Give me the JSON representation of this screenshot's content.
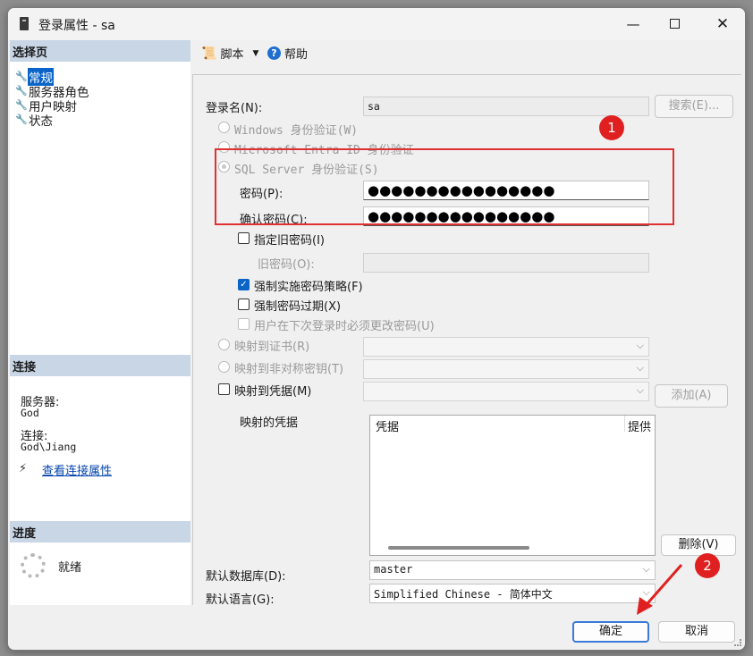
{
  "window": {
    "title": "登录属性 - sa"
  },
  "left": {
    "select_page_header": "选择页",
    "nav_items": [
      "常规",
      "服务器角色",
      "用户映射",
      "状态"
    ],
    "connection_header": "连接",
    "server_label": "服务器:",
    "server_value": "God",
    "connection_label": "连接:",
    "connection_value": "God\\Jiang",
    "view_connection_link": "查看连接属性",
    "progress_header": "进度",
    "progress_status": "就绪"
  },
  "toolbar": {
    "script_label": "脚本",
    "help_label": "帮助"
  },
  "form": {
    "login_name_label": "登录名(N):",
    "login_name_value": "sa",
    "search_button": "搜索(E)...",
    "windows_auth": "Windows 身份验证(W)",
    "entra_auth": "Microsoft Entra ID 身份验证",
    "sql_auth": "SQL Server 身份验证(S)",
    "password_label": "密码(P):",
    "password_value": "●●●●●●●●●●●●●●●●",
    "confirm_label": "确认密码(C):",
    "confirm_value": "●●●●●●●●●●●●●●●●",
    "old_pwd_check": "指定旧密码(I)",
    "old_pwd_label": "旧密码(O):",
    "enforce_policy": "强制实施密码策略(F)",
    "enforce_policy_checked": true,
    "enforce_expiration": "强制密码过期(X)",
    "must_change": "用户在下次登录时必须更改密码(U)",
    "map_cert": "映射到证书(R)",
    "map_asym": "映射到非对称密钥(T)",
    "map_credential": "映射到凭据(M)",
    "add_button": "添加(A)",
    "mapped_credentials_label": "映射的凭据",
    "list_col_credential": "凭据",
    "list_col_provider": "提供",
    "remove_button": "删除(V)",
    "default_db_label": "默认数据库(D):",
    "default_db_value": "master",
    "default_lang_label": "默认语言(G):",
    "default_lang_value": "Simplified Chinese - 简体中文"
  },
  "annotations": {
    "badge1": "1",
    "badge2": "2"
  },
  "footer": {
    "ok_button": "确定",
    "cancel_button": "取消"
  },
  "colors": {
    "annotation_red": "#e02020",
    "header_blue": "#c8d6e6",
    "selection_blue": "#0a64c8"
  }
}
